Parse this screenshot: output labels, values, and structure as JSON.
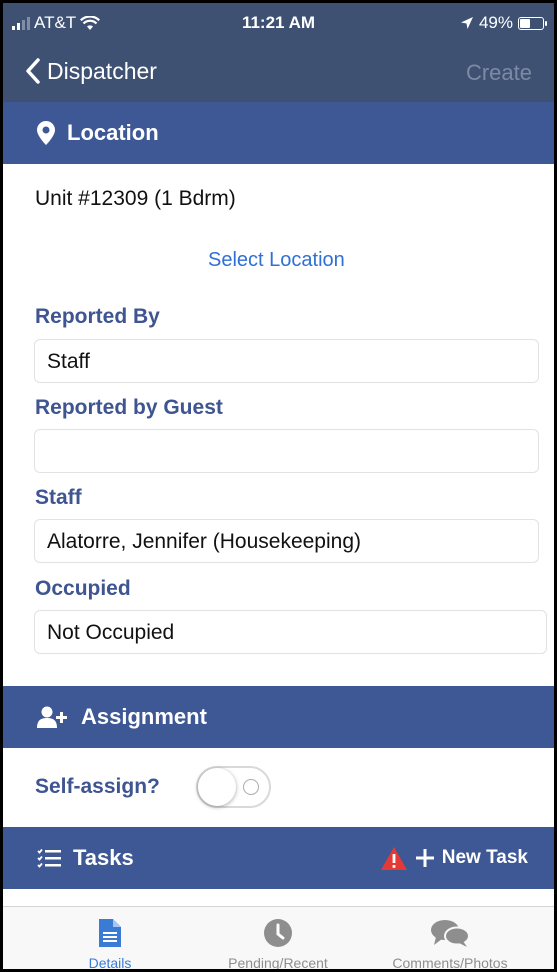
{
  "status_bar": {
    "carrier": "AT&T",
    "time": "11:21 AM",
    "battery_percent_label": "49%",
    "battery_level": 0.49
  },
  "nav": {
    "back_label": "Dispatcher",
    "create_label": "Create"
  },
  "location_section": {
    "title": "Location",
    "unit_text": "Unit #12309 (1 Bdrm)",
    "select_location_label": "Select Location",
    "fields": [
      {
        "label": "Reported By",
        "value": "Staff"
      },
      {
        "label": "Reported by Guest",
        "value": ""
      },
      {
        "label": "Staff",
        "value": "Alatorre, Jennifer (Housekeeping)"
      },
      {
        "label": "Occupied",
        "value": "Not Occupied"
      }
    ]
  },
  "assignment_section": {
    "title": "Assignment",
    "self_assign_label": "Self-assign?",
    "self_assign_on": false
  },
  "tasks_section": {
    "title": "Tasks",
    "new_task_label": "New Task"
  },
  "tab_bar": {
    "tabs": [
      {
        "label": "Details",
        "icon": "document-icon",
        "active": true
      },
      {
        "label": "Pending/Recent",
        "icon": "clock-icon",
        "active": false
      },
      {
        "label": "Comments/Photos",
        "icon": "chat-bubbles-icon",
        "active": false
      }
    ]
  },
  "colors": {
    "nav_background": "#3e5173",
    "section_header_background": "#3e5895",
    "label_color": "#3e5591",
    "link_color": "#2f6fd6",
    "warning_red": "#e53935",
    "tab_active": "#3a7bd5",
    "tab_inactive": "#8e8e8e"
  }
}
